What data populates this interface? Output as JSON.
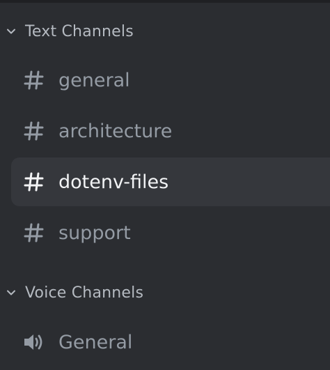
{
  "categories": [
    {
      "label": "Text Channels",
      "channels": [
        {
          "label": "general",
          "icon": "hash-icon"
        },
        {
          "label": "architecture",
          "icon": "hash-icon"
        },
        {
          "label": "dotenv-files",
          "icon": "hash-icon",
          "active": true
        },
        {
          "label": "support",
          "icon": "hash-icon"
        }
      ]
    },
    {
      "label": "Voice Channels",
      "channels": [
        {
          "label": "General",
          "icon": "speaker-icon"
        }
      ]
    }
  ],
  "colors": {
    "background": "#2b2d31",
    "active_row": "#35373c",
    "category_text": "#b5bac1",
    "channel_text": "#949ba4",
    "active_text": "#f2f3f5"
  }
}
